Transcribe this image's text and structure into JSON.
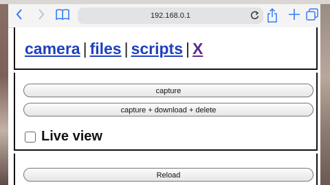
{
  "browser": {
    "url": "192.168.0.1",
    "icons": {
      "back": "chevron-left-icon",
      "forward": "chevron-right-icon",
      "bookmarks": "book-icon",
      "reload": "reload-icon",
      "share": "share-icon",
      "new_tab": "plus-icon",
      "tabs": "tabs-icon"
    },
    "accent_color": "#2f7cf6"
  },
  "nav": {
    "links": [
      {
        "label": "camera"
      },
      {
        "label": "files"
      },
      {
        "label": "scripts"
      },
      {
        "label": "X"
      }
    ],
    "separator": "|"
  },
  "controls": {
    "capture_label": "capture",
    "capture_download_label": "capture + download + delete",
    "live_view_label": "Live view",
    "live_view_checked": false,
    "reload_label": "Reload"
  }
}
